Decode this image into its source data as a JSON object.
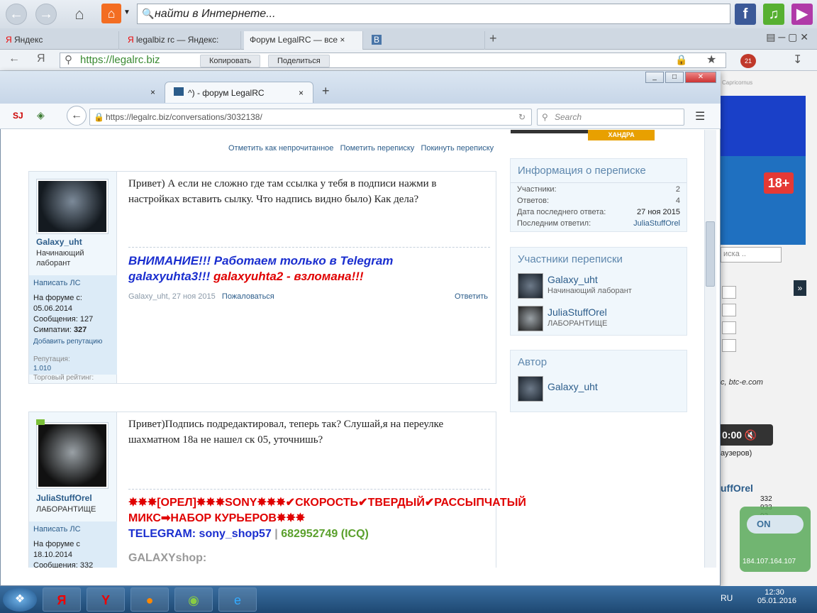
{
  "outer_browser": {
    "search_placeholder": "найти в Интернете...",
    "tabs": [
      "Яндекс",
      "legalbiz rc — Яндекс:",
      "Форум LegalRC — все",
      "В"
    ],
    "address": "https://legalrc.biz",
    "copy_label": "Копировать",
    "share_label": "Поделиться",
    "icons": [
      "back-icon",
      "forward-icon",
      "home-icon",
      "facebook-icon",
      "music-icon",
      "video-icon"
    ]
  },
  "right_panel": {
    "badge": "18+",
    "captcha_text": "Capricornus",
    "btc": "c, btc-e.com",
    "search_placeholder": "иска ..",
    "timer": "0:00",
    "users_text": "аузеров)",
    "user": "uffOrel",
    "nums": [
      "332",
      "933",
      "93"
    ],
    "vpn_label": "ON",
    "ip": "184.107.164.107"
  },
  "inner_browser": {
    "tab1": "",
    "tab2": "^) - форум LegalRC",
    "url": "https://legalrc.biz/conversations/3032138/",
    "search_placeholder": "Search",
    "banner_text": "ХАНДРА"
  },
  "actions": {
    "mark_unread": "Отметить как непрочитанное",
    "invite": "Пометить переписку",
    "leave": "Покинуть переписку"
  },
  "messages": [
    {
      "user": "Galaxy_uht",
      "title": "Начинающий лаборант",
      "pm": "Написать ЛС",
      "joined_label": "На форуме с:",
      "joined": "05.06.2014",
      "posts_label": "Сообщения:",
      "posts": "127",
      "likes_label": "Симпатии:",
      "likes": "327",
      "add_rep": "Добавить репутацию",
      "rep_label": "Репутация:",
      "rep": "1.010",
      "trade_label": "Торговый рейтинг:",
      "text": "Привет) А если не сложно где там ссылка у тебя в подписи нажми в настройках вставить сылку. Что надпись видно было) Как дела?",
      "sig1": "ВНИМАНИЕ!!! Работаем только в Telegram",
      "sig2a": "galaxyuhta3!!!",
      "sig2b": "galaxyuhta2 - взломана!!!",
      "meta": "Galaxy_uht, 27 ноя 2015",
      "report": "Пожаловаться",
      "reply": "Ответить"
    },
    {
      "user": "JuliaStuffOrel",
      "title": "ЛАБОРАНТИЩЕ",
      "pm": "Написать ЛС",
      "joined_label": "На форуме с",
      "joined": "18.10.2014",
      "posts_label": "Сообщения:",
      "posts": "332",
      "text": "Привет)Подпись подредактировал, теперь так? Слушай,я на переулке шахматном 18а не нашел ск 05, уточнишь?",
      "sig1": "✸✸✸[ОРЕЛ]✸✸✸SONY✸✸✸✔СКОРОСТЬ✔ТВЕРДЫЙ✔РАССЫПЧАТЫЙ МИКС➡НАБОР КУРЬЕРОВ✸✸✸",
      "sig2a": "TELEGRAM: sony_shop57",
      "sig2sep": "|",
      "sig2b": "682952749 (ICQ)",
      "sig3": "GALAXYshop:"
    }
  ],
  "info": {
    "title": "Информация о переписке",
    "rows": [
      [
        "Участники:",
        "2"
      ],
      [
        "Ответов:",
        "4"
      ],
      [
        "Дата последнего ответа:",
        "27 ноя 2015"
      ],
      [
        "Последним ответил:",
        "JuliaStuffOrel"
      ]
    ]
  },
  "participants": {
    "title": "Участники переписки",
    "list": [
      {
        "name": "Galaxy_uht",
        "role": "Начинающий лаборант"
      },
      {
        "name": "JuliaStuffOrel",
        "role": "ЛАБОРАНТИЩЕ"
      }
    ]
  },
  "author": {
    "title": "Автор",
    "name": "Galaxy_uht"
  },
  "taskbar": {
    "lang": "RU",
    "time": "12:30",
    "date": "05.01.2016",
    "colors": {
      "accent": "#2b5c8a",
      "red": "#e00000",
      "blue": "#1a2ecf",
      "green": "#5aa02c"
    }
  }
}
